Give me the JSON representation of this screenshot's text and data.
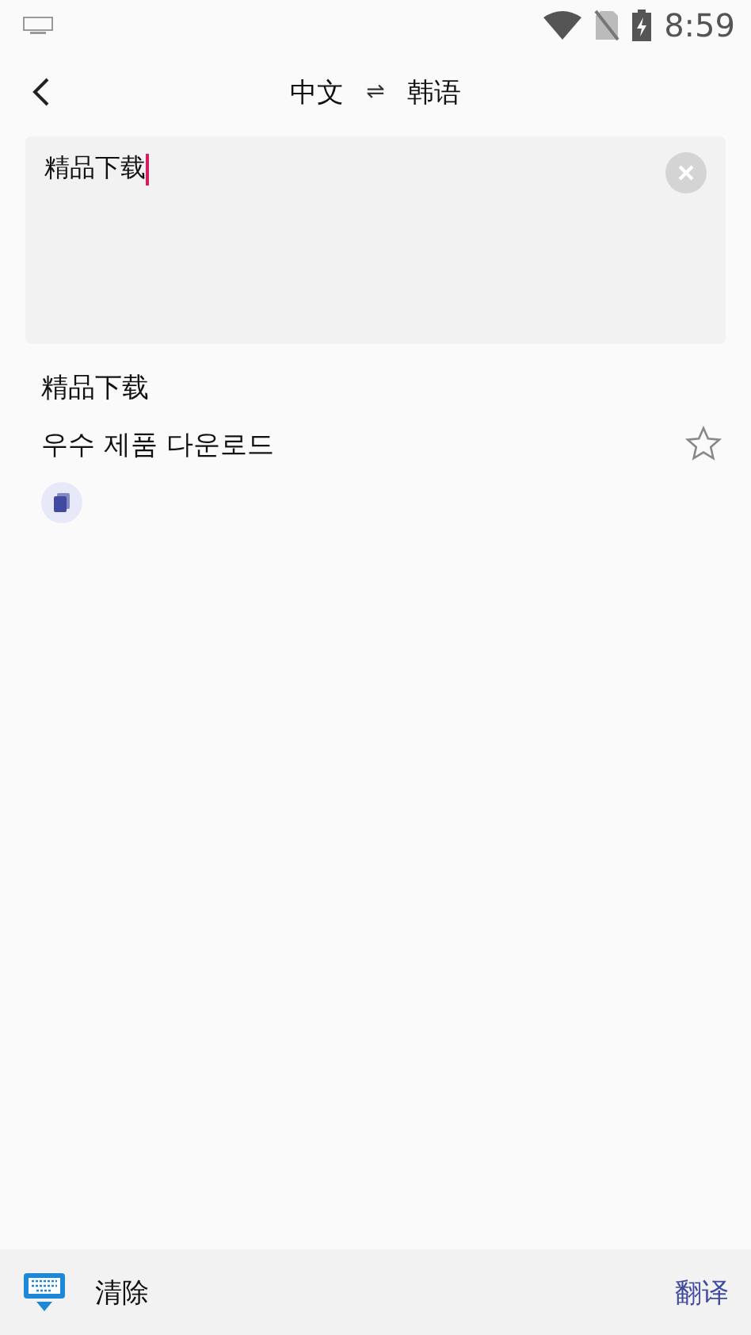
{
  "status_bar": {
    "time": "8:59"
  },
  "header": {
    "source_language": "中文",
    "swap": "⇌",
    "target_language": "韩语"
  },
  "input": {
    "value": "精品下载"
  },
  "result": {
    "source": "精品下载",
    "translation": "우수 제품 다운로드"
  },
  "bottom_bar": {
    "clear": "清除",
    "translate": "翻译"
  }
}
